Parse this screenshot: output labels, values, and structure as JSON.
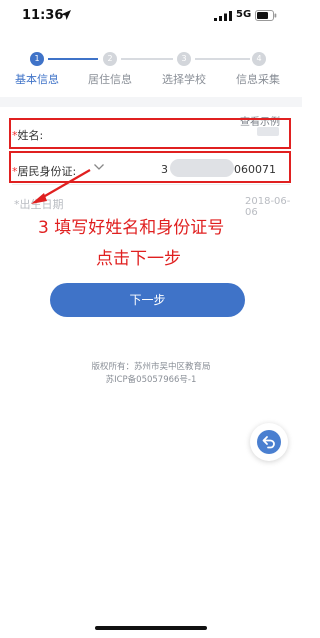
{
  "status_bar": {
    "time": "11:36",
    "network": "5G",
    "icons": [
      "location-arrow-icon",
      "signal-icon",
      "battery-icon"
    ]
  },
  "stepper": {
    "steps": [
      {
        "num": "1",
        "label": "基本信息",
        "active": true
      },
      {
        "num": "2",
        "label": "居住信息",
        "active": false
      },
      {
        "num": "3",
        "label": "选择学校",
        "active": false
      },
      {
        "num": "4",
        "label": "信息采集",
        "active": false
      }
    ]
  },
  "form": {
    "view_example": "查看示例",
    "name_required": "*",
    "name_label": "姓名:",
    "id_required": "*",
    "id_label": "居民身份证:",
    "id_value_start": "3",
    "id_value_end": "060071",
    "dob_label": "*出生日期",
    "dob_value": "2018-06-06"
  },
  "annotation": {
    "line1": "3  填写好姓名和身份证号",
    "line2": "点击下一步"
  },
  "next_button": "下一步",
  "footer": {
    "copyright": "版权所有：苏州市吴中区教育局",
    "icp": "苏ICP备05057966号-1"
  },
  "colors": {
    "accent": "#3f73c8",
    "annotation": "#e02020",
    "required": "#e33"
  }
}
